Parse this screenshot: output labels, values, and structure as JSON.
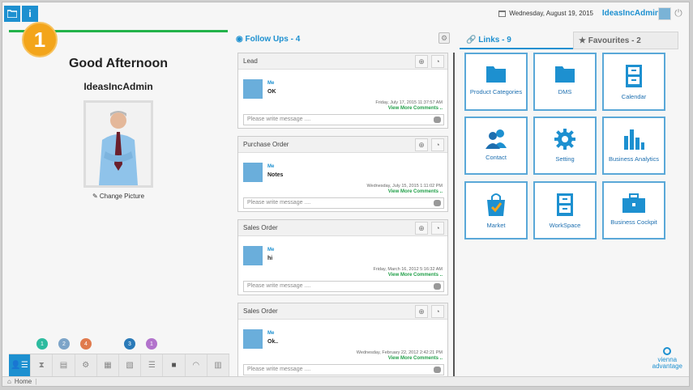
{
  "topbar": {
    "info_label": "i",
    "date": "Wednesday, August 19, 2015",
    "user": "IdeasIncAdmin"
  },
  "step_badge": "1",
  "profile": {
    "greeting": "Good Afternoon",
    "username": "IdeasIncAdmin",
    "change_picture": "Change Picture"
  },
  "notif_dots": [
    {
      "count": "1",
      "color": "#2dbb9f"
    },
    {
      "count": "2",
      "color": "#7ca4c8"
    },
    {
      "count": "4",
      "color": "#e07a4d"
    },
    {
      "count": "3",
      "color": "#2a7ab8"
    },
    {
      "count": "1",
      "color": "#b273cc"
    }
  ],
  "status": {
    "home": "Home"
  },
  "followups": {
    "title": "Follow Ups - 4",
    "cards": [
      {
        "title": "Lead",
        "from": "Me",
        "text": "OK",
        "date": "Friday, July 17, 2015 11:37:57 AM",
        "more": "View More Comments ..",
        "placeholder": "Please write message ...."
      },
      {
        "title": "Purchase Order",
        "from": "Me",
        "text": "Notes",
        "date": "Wednesday, July 15, 2015 1:11:02 PM",
        "more": "View More Comments ..",
        "placeholder": "Please write message ...."
      },
      {
        "title": "Sales Order",
        "from": "Me",
        "text": "hi",
        "date": "Friday, March 16, 2012 5:16:32 AM",
        "more": "View More Comments ..",
        "placeholder": "Please write message ...."
      },
      {
        "title": "Sales Order",
        "from": "Me",
        "text": "Ok..",
        "date": "Wednesday, February 22, 2012 2:42:21 PM",
        "more": "View More Comments ..",
        "placeholder": "Please write message ...."
      }
    ]
  },
  "tabs": {
    "links": "Links - 9",
    "favourites": "Favourites - 2"
  },
  "links": [
    {
      "label": "Product Categories",
      "icon": "folder-icon"
    },
    {
      "label": "DMS",
      "icon": "folder-icon"
    },
    {
      "label": "Calendar",
      "icon": "cabinet-icon"
    },
    {
      "label": "Contact",
      "icon": "contact-icon"
    },
    {
      "label": "Setting",
      "icon": "gear-icon"
    },
    {
      "label": "Business Analytics",
      "icon": "bar-chart-icon"
    },
    {
      "label": "Market",
      "icon": "shopping-bag-icon"
    },
    {
      "label": "WorkSpace",
      "icon": "cabinet-icon"
    },
    {
      "label": "Business Cockpit",
      "icon": "briefcase-icon"
    }
  ],
  "brand": {
    "line1": "vienna",
    "line2": "advantage"
  },
  "colors": {
    "accent": "#1d90d0",
    "green": "#23b34a",
    "badge": "#f3a51b"
  }
}
